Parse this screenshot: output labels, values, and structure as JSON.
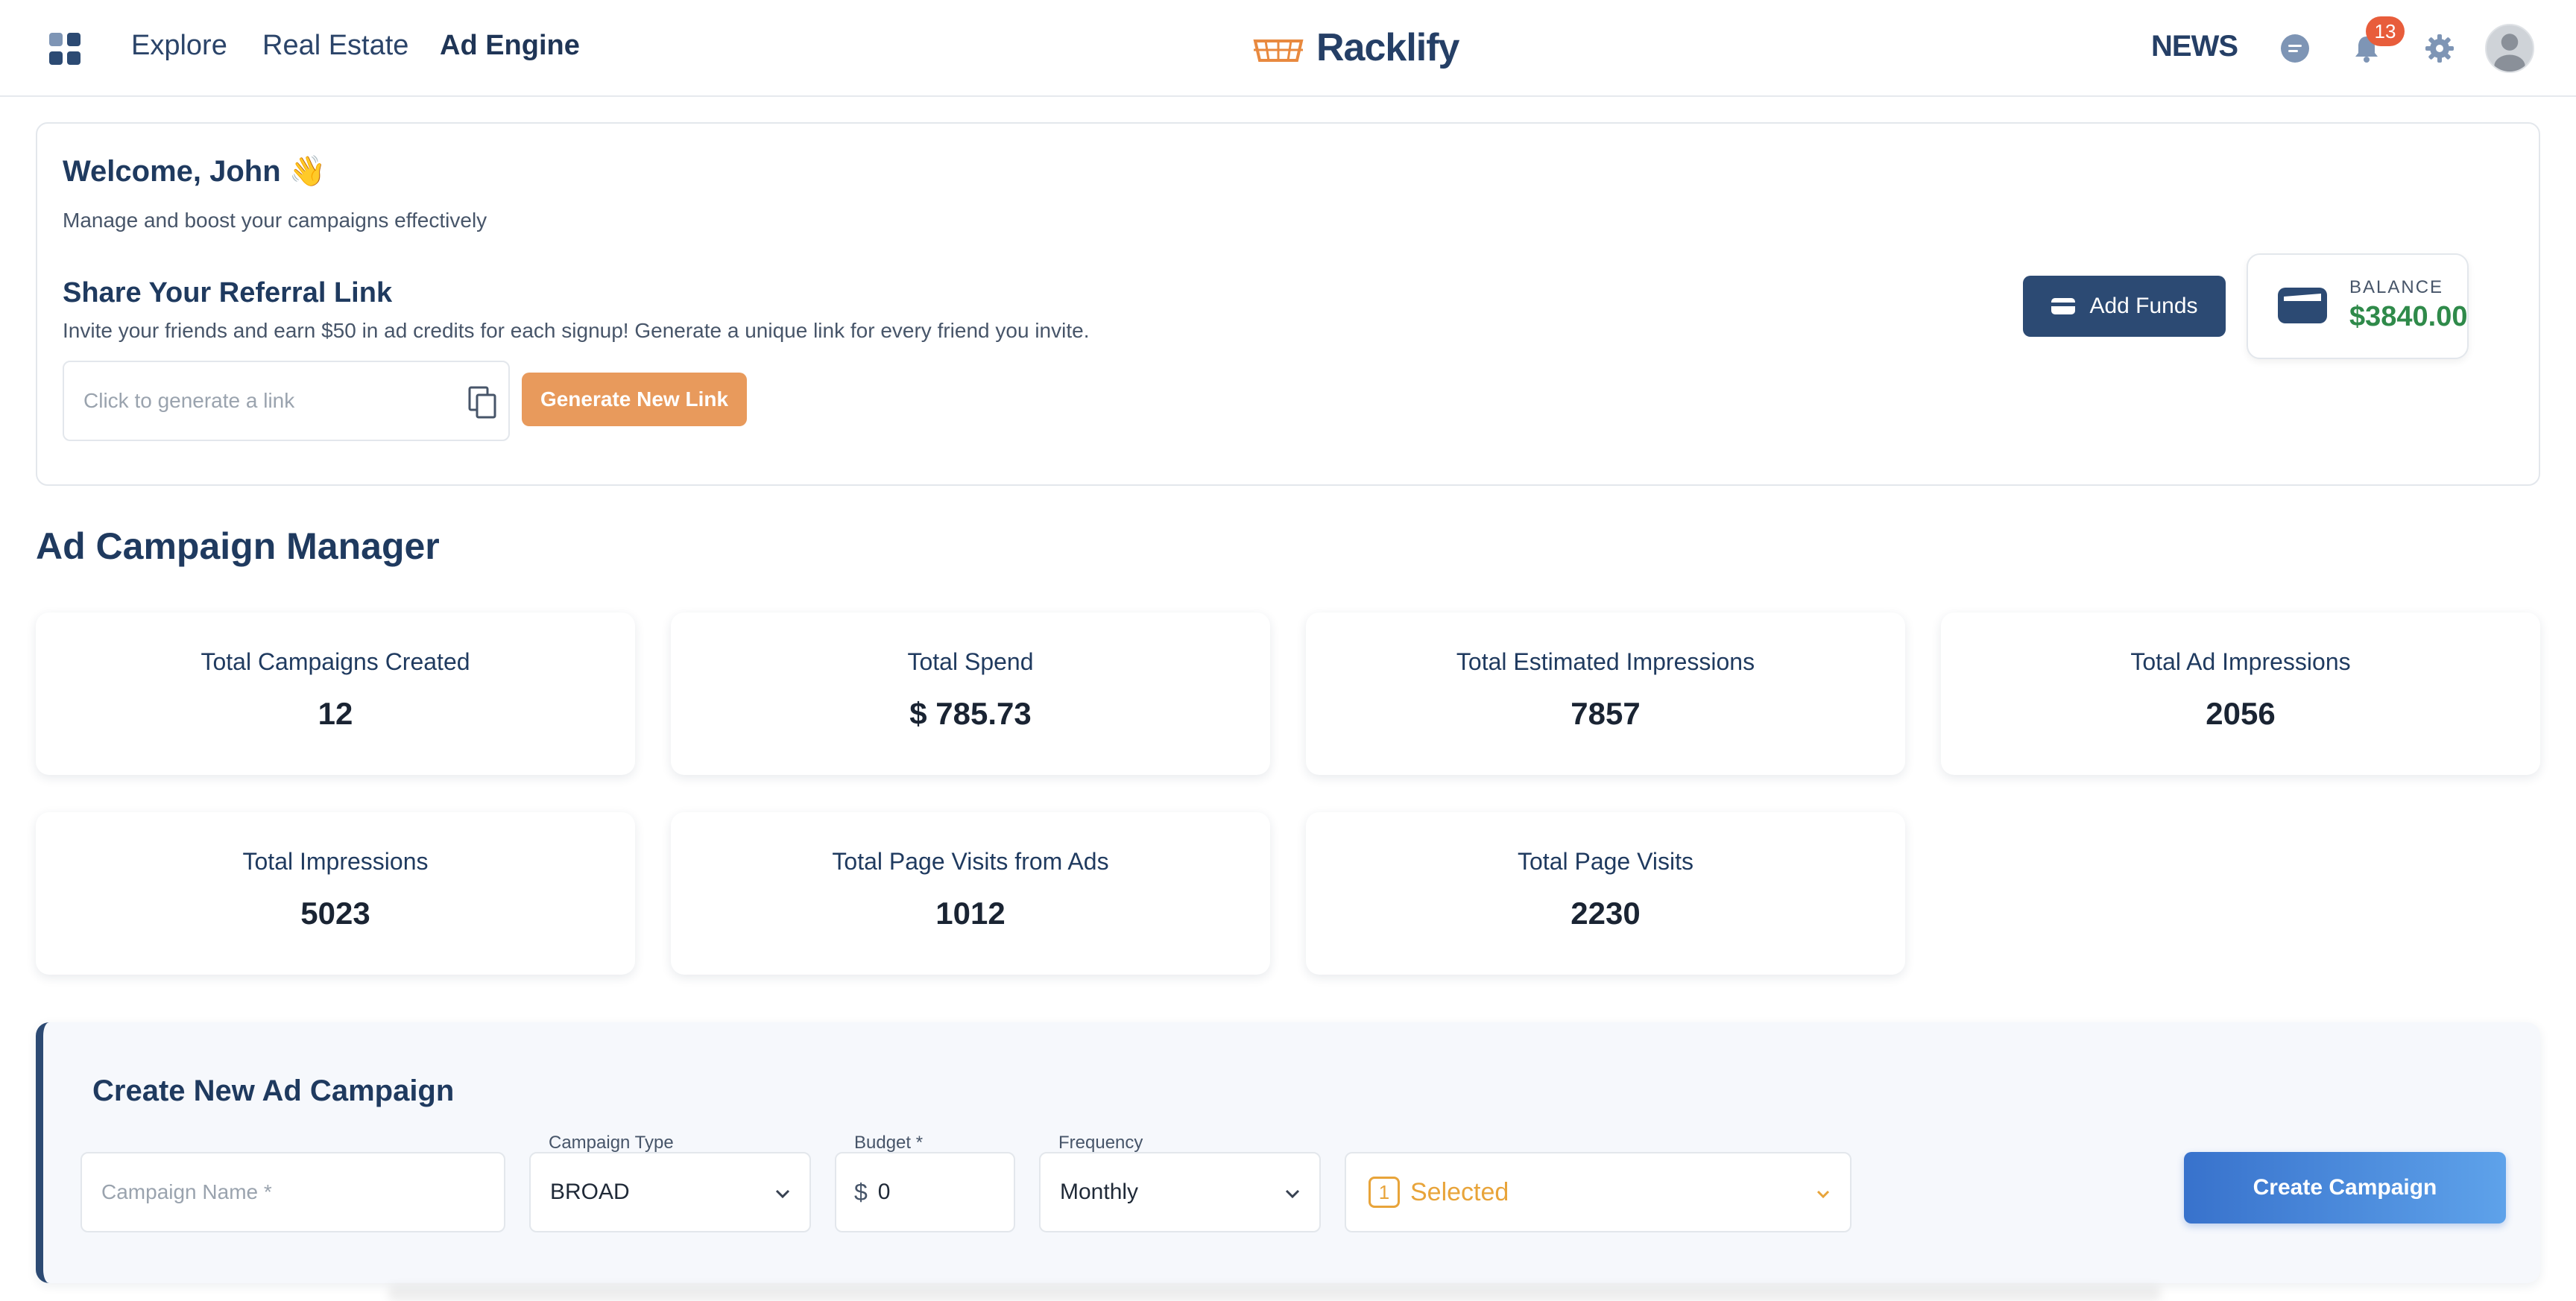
{
  "nav": {
    "links": [
      {
        "label": "Explore"
      },
      {
        "label": "Real Estate"
      },
      {
        "label": "Ad Engine"
      }
    ],
    "brand": "Racklify",
    "news": "NEWS",
    "notification_count": "13",
    "icons": [
      "apps-grid-icon",
      "chat-icon",
      "bell-icon",
      "gear-icon",
      "avatar"
    ]
  },
  "welcome": {
    "title": "Welcome, John 👋",
    "subtitle": "Manage and boost your campaigns effectively",
    "referral_title": "Share Your Referral Link",
    "referral_desc": "Invite your friends and earn $50 in ad credits for each signup! Generate a unique link for every friend you invite.",
    "link_placeholder": "Click to generate a link",
    "generate_button": "Generate New Link",
    "add_funds_button": "Add Funds",
    "balance_label": "BALANCE",
    "balance_value": "$3840.00"
  },
  "manager": {
    "title": "Ad Campaign Manager",
    "stats": [
      {
        "label": "Total Campaigns Created",
        "value": "12"
      },
      {
        "label": "Total Spend",
        "value": "$ 785.73"
      },
      {
        "label": "Total Estimated Impressions",
        "value": "7857"
      },
      {
        "label": "Total Ad Impressions",
        "value": "2056"
      },
      {
        "label": "Total Impressions",
        "value": "5023"
      },
      {
        "label": "Total Page Visits from Ads",
        "value": "1012"
      },
      {
        "label": "Total Page Visits",
        "value": "2230"
      }
    ]
  },
  "create": {
    "title": "Create New Ad Campaign",
    "name_placeholder": "Campaign Name *",
    "type_label": "Campaign Type",
    "type_value": "BROAD",
    "budget_label": "Budget *",
    "budget_currency": "$",
    "budget_value": "0",
    "frequency_label": "Frequency",
    "frequency_value": "Monthly",
    "selected_count": "1",
    "selected_label": "Selected",
    "create_button": "Create Campaign"
  },
  "colors": {
    "primary": "#2c4a73",
    "accent_orange": "#e89a5c",
    "balance_green": "#2f8a4a",
    "badge_red": "#e85d3b",
    "create_blue": "#3872cc"
  }
}
